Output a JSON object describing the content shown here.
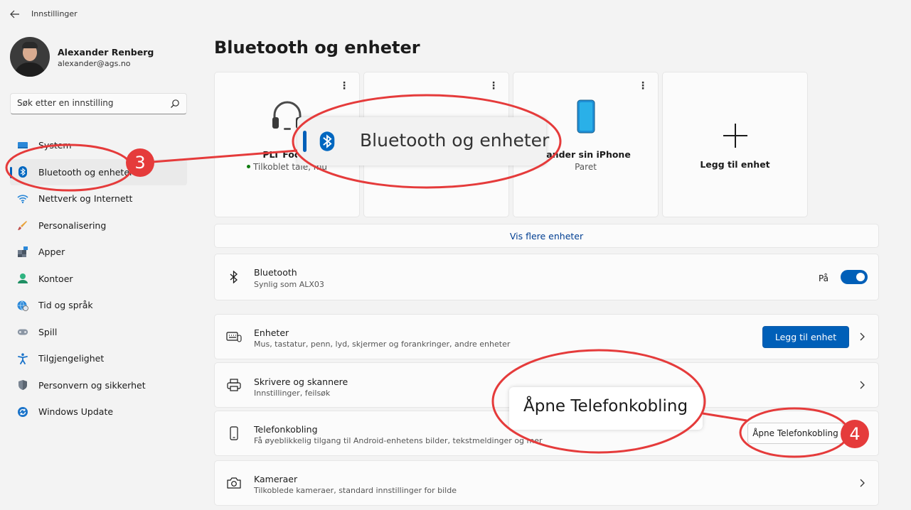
{
  "window": {
    "title": "Innstillinger"
  },
  "profile": {
    "name": "Alexander Renberg",
    "email": "alexander@ags.no"
  },
  "search": {
    "placeholder": "Søk etter en innstilling"
  },
  "sidebar": {
    "items": [
      {
        "label": "System",
        "icon": "system-icon"
      },
      {
        "label": "Bluetooth og enheter",
        "icon": "bluetooth-icon",
        "active": true
      },
      {
        "label": "Nettverk og Internett",
        "icon": "wifi-icon"
      },
      {
        "label": "Personalisering",
        "icon": "brush-icon"
      },
      {
        "label": "Apper",
        "icon": "apps-icon"
      },
      {
        "label": "Kontoer",
        "icon": "account-icon"
      },
      {
        "label": "Tid og språk",
        "icon": "globe-clock-icon"
      },
      {
        "label": "Spill",
        "icon": "gamepad-icon"
      },
      {
        "label": "Tilgjengelighet",
        "icon": "accessibility-icon"
      },
      {
        "label": "Personvern og sikkerhet",
        "icon": "shield-icon"
      },
      {
        "label": "Windows Update",
        "icon": "update-icon"
      }
    ]
  },
  "main": {
    "title": "Bluetooth og enheter",
    "devices": [
      {
        "name": "PLT Focus",
        "status": "Tilkoblet tale, mu",
        "icon": "headset-icon"
      },
      {
        "name": "",
        "status": "",
        "icon": ""
      },
      {
        "name": "xander sin iPhone",
        "status": "Paret",
        "icon": "phone-icon"
      }
    ],
    "add_device_card": {
      "label": "Legg til enhet"
    },
    "show_more": "Vis flere enheter",
    "bluetooth": {
      "title": "Bluetooth",
      "subtitle": "Synlig som ALX03",
      "toggle_label": "På",
      "on": true
    },
    "rows": {
      "devices": {
        "title": "Enheter",
        "subtitle": "Mus, tastatur, penn, lyd, skjermer og forankringer, andre enheter",
        "button": "Legg til enhet"
      },
      "printers": {
        "title": "Skrivere og skannere",
        "subtitle": "Innstillinger, feilsøk"
      },
      "phone_link": {
        "title": "Telefonkobling",
        "subtitle": "Få øyeblikkelig tilgang til Android-enhetens bilder, tekstmeldinger og mer",
        "button": "Åpne Telefonkobling"
      },
      "cameras": {
        "title": "Kameraer",
        "subtitle": "Tilkoblede kameraer, standard innstillinger for bilde"
      }
    }
  },
  "annotations": {
    "zoom_sidebar_text": "Bluetooth og enheter",
    "zoom_button_text": "Åpne Telefonkobling",
    "step_sidebar": "3",
    "step_button": "4",
    "color": "#e53b3b"
  },
  "colors": {
    "accent": "#005fb8",
    "link": "#003e92",
    "online": "#0f7b0f"
  }
}
